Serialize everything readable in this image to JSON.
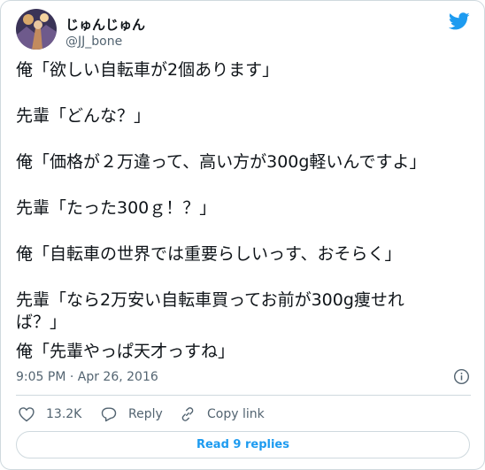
{
  "tweet": {
    "author_name": "じゅんじゅん",
    "author_handle": "@JJ_bone",
    "lines": [
      "俺「欲しい自転車が2個あります」",
      "先輩「どんな？」",
      "俺「価格が２万違って、高い方が300g軽いんですよ」",
      "先輩「たった300ｇ！？」",
      "俺「自転車の世界では重要らしいっす、おそらく」",
      "先輩「なら2万安い自転車買ってお前が300g痩せれ",
      "ば？」",
      "俺「先輩やっぱ天才っすね」"
    ],
    "timestamp": "9:05 PM · Apr 26, 2016"
  },
  "actions": {
    "like_count": "13.2K",
    "reply_label": "Reply",
    "copy_link_label": "Copy link"
  },
  "replies_button": "Read 9 replies",
  "icons": [
    "twitter-bird-icon",
    "info-icon",
    "heart-icon",
    "reply-icon",
    "link-icon"
  ],
  "colors": {
    "brand": "#1d9bf0",
    "text": "#0f1419",
    "muted": "#536471",
    "border": "#cfd9de"
  }
}
